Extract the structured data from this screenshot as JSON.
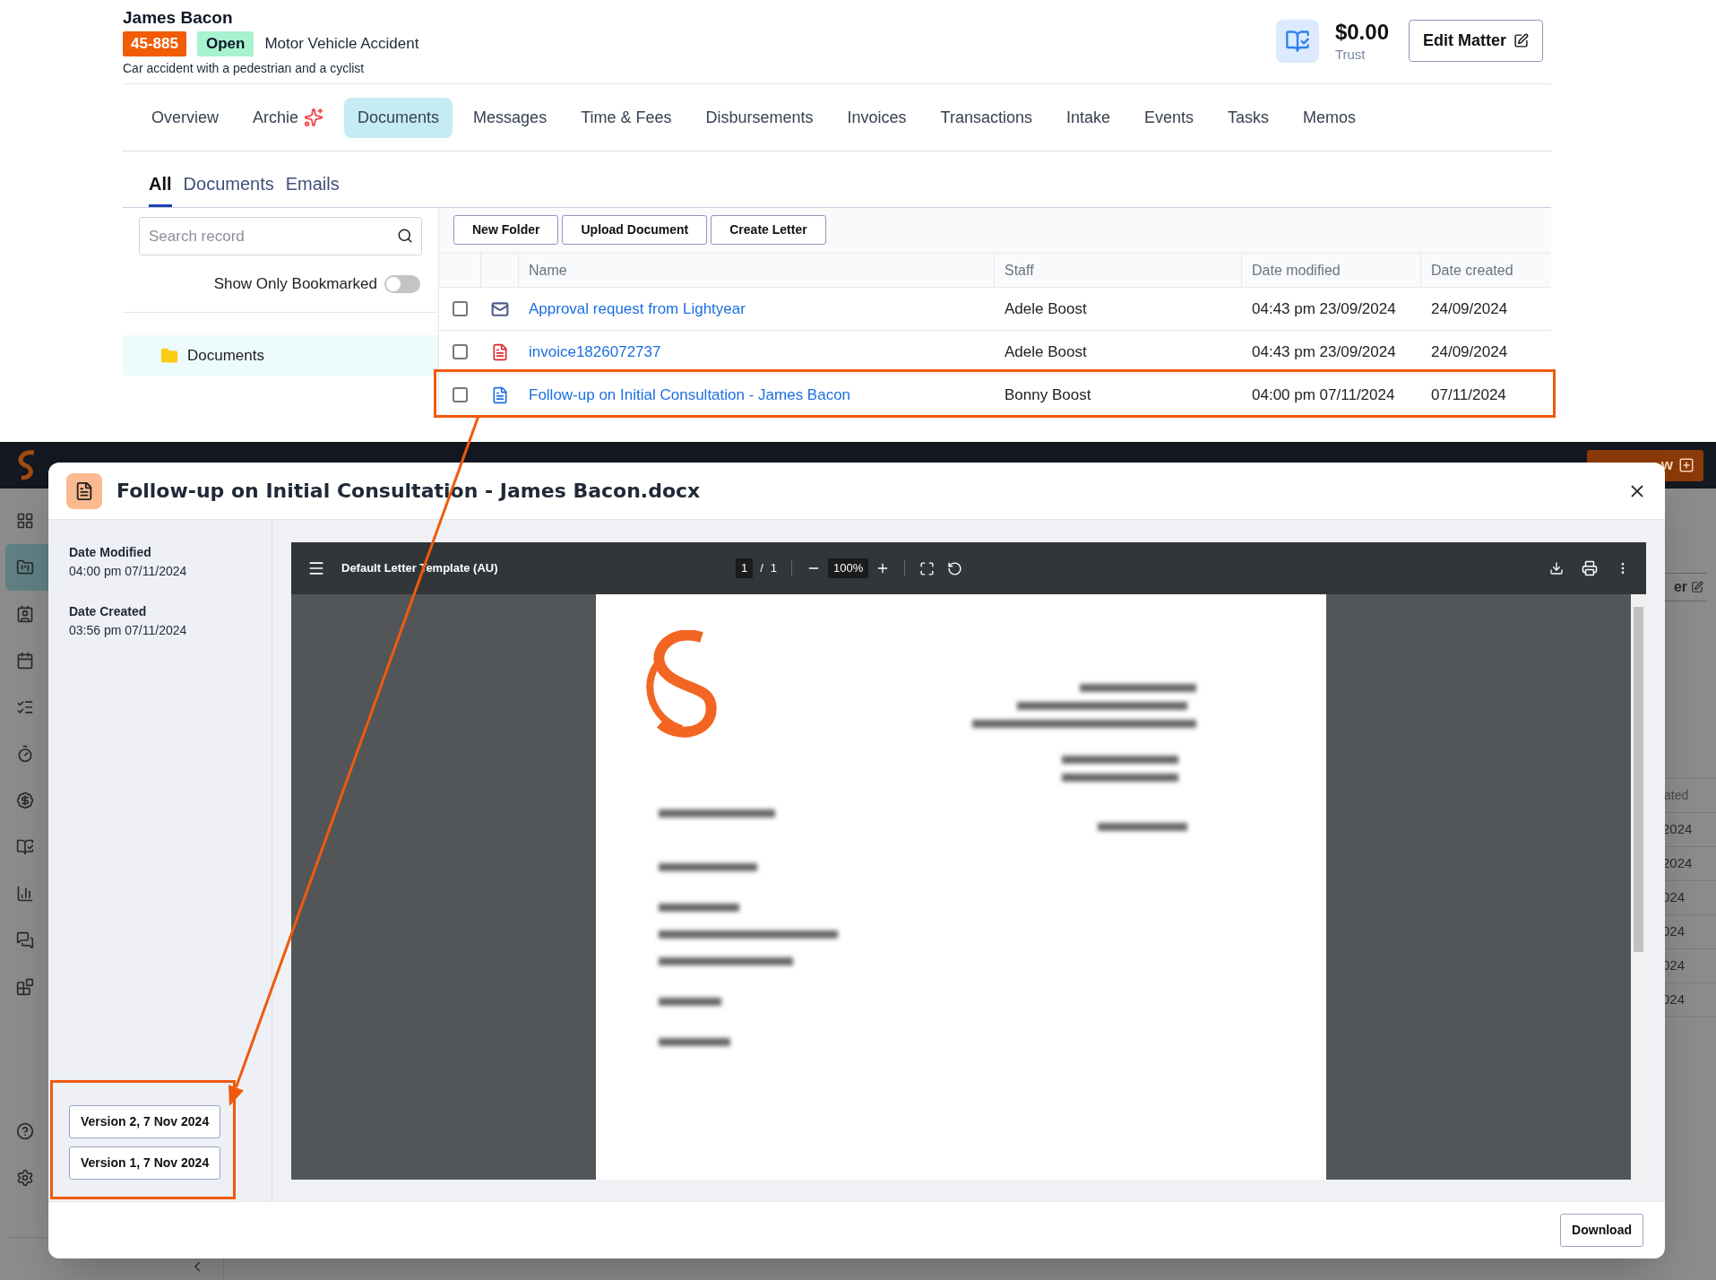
{
  "matter": {
    "client": "James Bacon",
    "number": "45-885",
    "status": "Open",
    "type": "Motor Vehicle Accident",
    "description": "Car accident with a pedestrian and a cyclist"
  },
  "trust": {
    "amount": "$0.00",
    "label": "Trust"
  },
  "edit_button": "Edit Matter",
  "tabs": [
    {
      "label": "Overview",
      "selected": false,
      "kind": "plain"
    },
    {
      "label": "Archie",
      "selected": false,
      "kind": "ai"
    },
    {
      "label": "Documents",
      "selected": true,
      "kind": "plain"
    },
    {
      "label": "Messages",
      "selected": false,
      "kind": "plain"
    },
    {
      "label": "Time & Fees",
      "selected": false,
      "kind": "plain"
    },
    {
      "label": "Disbursements",
      "selected": false,
      "kind": "plain"
    },
    {
      "label": "Invoices",
      "selected": false,
      "kind": "plain"
    },
    {
      "label": "Transactions",
      "selected": false,
      "kind": "plain"
    },
    {
      "label": "Intake",
      "selected": false,
      "kind": "plain"
    },
    {
      "label": "Events",
      "selected": false,
      "kind": "plain"
    },
    {
      "label": "Tasks",
      "selected": false,
      "kind": "plain"
    },
    {
      "label": "Memos",
      "selected": false,
      "kind": "plain"
    }
  ],
  "subtabs": [
    {
      "label": "All",
      "selected": true
    },
    {
      "label": "Documents",
      "selected": false
    },
    {
      "label": "Emails",
      "selected": false
    }
  ],
  "search": {
    "placeholder": "Search record"
  },
  "bookmark_filter": {
    "label": "Show Only Bookmarked",
    "on": false
  },
  "folders": [
    {
      "name": "Documents",
      "selected": true
    }
  ],
  "toolbar_buttons": [
    "New Folder",
    "Upload Document",
    "Create Letter"
  ],
  "table": {
    "columns": [
      "Name",
      "Staff",
      "Date modified",
      "Date created"
    ],
    "rows": [
      {
        "kind": "email",
        "name": "Approval request from Lightyear",
        "staff": "Adele Boost",
        "modified": "04:43 pm 23/09/2024",
        "created": "24/09/2024",
        "checked": false,
        "highlighted": false
      },
      {
        "kind": "pdf",
        "name": "invoice1826072737",
        "staff": "Adele Boost",
        "modified": "04:43 pm 23/09/2024",
        "created": "24/09/2024",
        "checked": false,
        "highlighted": false
      },
      {
        "kind": "doc",
        "name": "Follow-up on Initial Consultation - James Bacon",
        "staff": "Bonny Boost",
        "modified": "04:00 pm 07/11/2024",
        "created": "07/11/2024",
        "checked": false,
        "highlighted": true
      }
    ]
  },
  "background_app": {
    "sidebar": [
      {
        "selected": false
      },
      {
        "selected": true
      },
      {
        "selected": false
      },
      {
        "selected": false
      },
      {
        "selected": false
      },
      {
        "selected": false
      },
      {
        "selected": false
      },
      {
        "selected": false
      },
      {
        "selected": false
      },
      {
        "selected": false
      },
      {
        "selected": false
      }
    ],
    "new_button": "w",
    "edit_button": "er",
    "column_fragment": "ated",
    "cell_fragments": [
      "2024",
      "2024",
      "024",
      "024",
      "024",
      "024"
    ]
  },
  "dialog": {
    "title": "Follow-up on Initial Consultation - James Bacon.docx",
    "meta": [
      {
        "label": "Date Modified",
        "value": "04:00 pm 07/11/2024"
      },
      {
        "label": "Date Created",
        "value": "03:56 pm 07/11/2024"
      }
    ],
    "versions": [
      "Version 2, 7 Nov 2024",
      "Version 1, 7 Nov 2024"
    ],
    "versions_highlighted": true,
    "viewer": {
      "title": "Default Letter Template (AU)",
      "page": "1",
      "separator": "/",
      "pages": "1",
      "zoom": "100%"
    },
    "download": "Download"
  }
}
